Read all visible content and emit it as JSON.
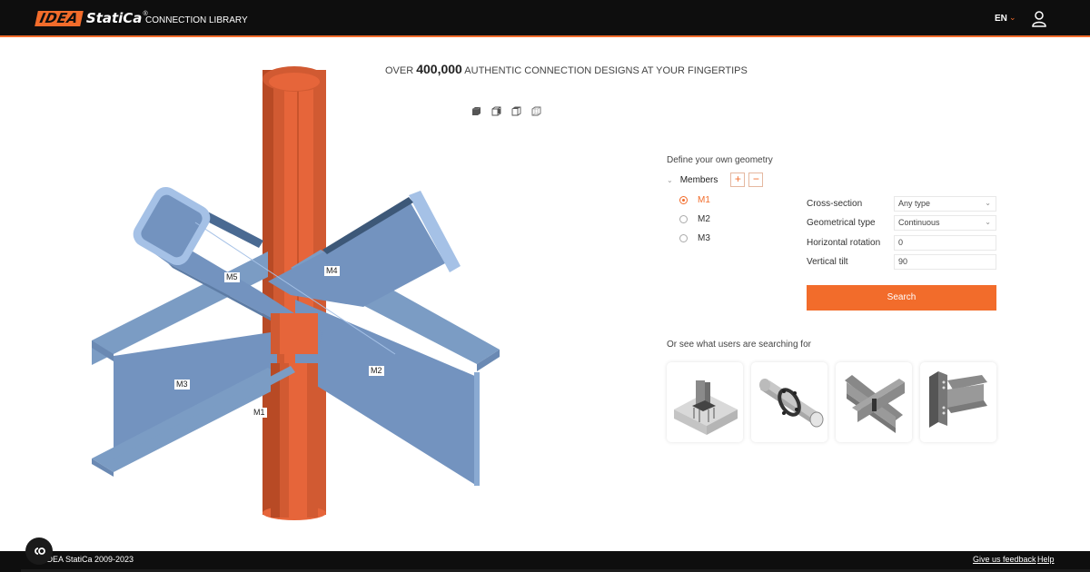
{
  "header": {
    "logo_idea": "IDEA",
    "logo_statica": "StatiCa",
    "logo_reg": "®",
    "title": "CONNECTION LIBRARY",
    "language": "EN",
    "language_chevron_icon": "chevron-down-icon",
    "user_icon": "user-icon"
  },
  "main": {
    "tagline_prefix": "OVER ",
    "tagline_number": "400,000",
    "tagline_suffix": " AUTHENTIC CONNECTION DESIGNS AT YOUR FINGERTIPS",
    "view_icons": [
      "solid-view-icon",
      "front-view-icon",
      "top-view-icon",
      "wireframe-view-icon"
    ],
    "model_labels": {
      "m1": "M1",
      "m2": "M2",
      "m3": "M3",
      "m4": "M4",
      "m5": "M5"
    },
    "colors": {
      "column": "#e6653a",
      "beam": "#7b9cc4",
      "accent": "#f26c2b"
    }
  },
  "panel": {
    "define_title": "Define your own geometry",
    "members_label": "Members",
    "add_label": "+",
    "remove_label": "−",
    "members": [
      {
        "label": "M1",
        "selected": true
      },
      {
        "label": "M2",
        "selected": false
      },
      {
        "label": "M3",
        "selected": false
      }
    ],
    "form": {
      "cross_section_label": "Cross-section",
      "cross_section_value": "Any type",
      "geometrical_type_label": "Geometrical type",
      "geometrical_type_value": "Continuous",
      "horizontal_rotation_label": "Horizontal rotation",
      "horizontal_rotation_value": "0",
      "vertical_tilt_label": "Vertical tilt",
      "vertical_tilt_value": "90"
    },
    "search_label": "Search",
    "see_users_label": "Or see what users are searching for",
    "popular": [
      {
        "name": "base-plate-connection"
      },
      {
        "name": "pipe-flange-connection"
      },
      {
        "name": "beam-cross-connection"
      },
      {
        "name": "column-beam-connection"
      }
    ]
  },
  "footer": {
    "copyright": "IDEA StatiCa 2009-2023",
    "feedback": "Give us feedback",
    "help": "Help",
    "chat_icon": "chat-icon"
  }
}
